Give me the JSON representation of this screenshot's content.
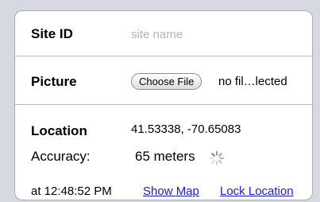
{
  "form": {
    "site": {
      "label": "Site ID",
      "value": "",
      "placeholder": "site name"
    },
    "picture": {
      "label": "Picture",
      "button_label": "Choose File",
      "file_status": "no fil…lected"
    },
    "location": {
      "label": "Location",
      "coordinates": "41.53338, -70.65083",
      "accuracy_label": "Accuracy:",
      "accuracy_value": "65 meters",
      "spinner_icon": "loading-spinner-icon",
      "timestamp": "at 12:48:52 PM",
      "show_map_label": "Show Map",
      "lock_location_label": "Lock Location"
    }
  },
  "colors": {
    "background": "#d6d9df",
    "card": "#ffffff",
    "link": "#1a1adb",
    "placeholder": "#b5b5b5"
  }
}
